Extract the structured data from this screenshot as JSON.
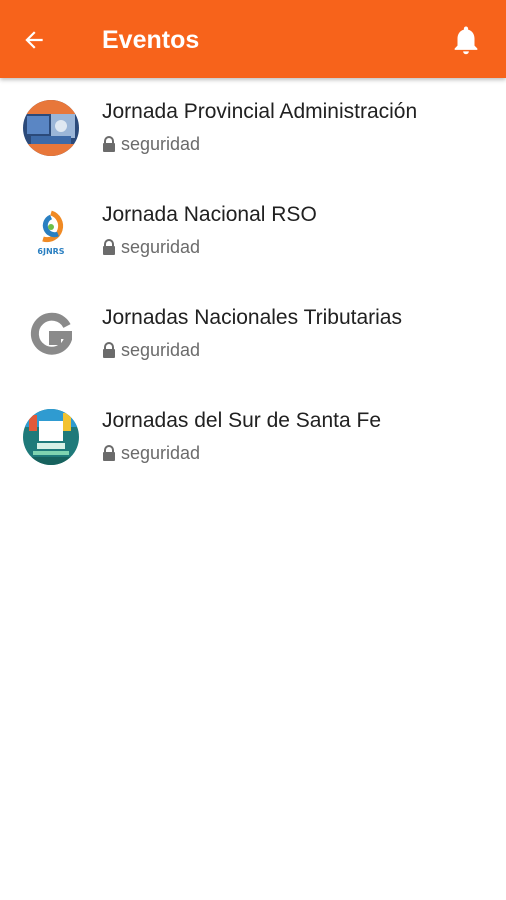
{
  "appbar": {
    "title": "Eventos",
    "color": "#f7631b",
    "back_icon": "arrow-left-icon",
    "bell_icon": "bell-icon"
  },
  "events": [
    {
      "title": "Jornada Provincial Administración",
      "subtitle": "seguridad",
      "icon": "lock-icon"
    },
    {
      "title": "Jornada Nacional RSO",
      "subtitle": "seguridad",
      "icon": "lock-icon",
      "logo_text": "6JNRS"
    },
    {
      "title": "Jornadas Nacionales Tributarias",
      "subtitle": "seguridad",
      "icon": "lock-icon"
    },
    {
      "title": "Jornadas del Sur de Santa Fe",
      "subtitle": "seguridad",
      "icon": "lock-icon"
    }
  ]
}
